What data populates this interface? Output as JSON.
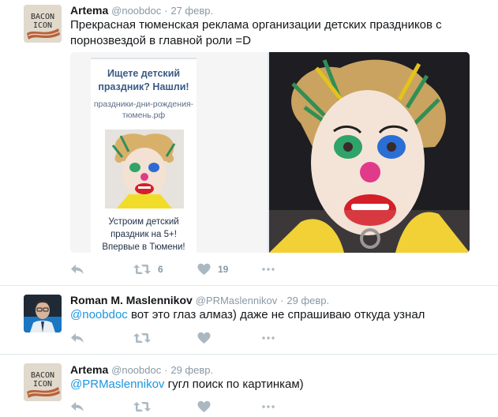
{
  "tweets": [
    {
      "author": "Artema",
      "handle": "@noobdoc",
      "time": "27 февр.",
      "text": "Прекрасная тюменская реклама организации детских праздников с порнозвездой в главной роли =D",
      "ad": {
        "title": "Ищете детский праздник? Нашли!",
        "site": "праздники-дни-рождения-тюмень.рф",
        "bottom": "Устроим детский праздник на 5+! Впервые в Тюмени!"
      },
      "retweets": "6",
      "likes": "19"
    },
    {
      "author": "Roman M. Maslennikov",
      "handle": "@PRMaslennikov",
      "time": "29 февр.",
      "mention": "@noobdoc",
      "text": " вот это глаз алмаз) даже не спрашиваю откуда узнал"
    },
    {
      "author": "Artema",
      "handle": "@noobdoc",
      "time": "29 февр.",
      "mention": "@PRMaslennikov",
      "text": " гугл поиск по картинкам)"
    }
  ],
  "avatar_text": [
    "BACON",
    "ICON"
  ],
  "icons": [
    "reply-icon",
    "retweet-icon",
    "heart-icon",
    "more-icon"
  ],
  "colors": {
    "link": "#1b95e0",
    "muted": "#8899a6",
    "action": "#aab8c2",
    "border": "#e1e8ed"
  }
}
